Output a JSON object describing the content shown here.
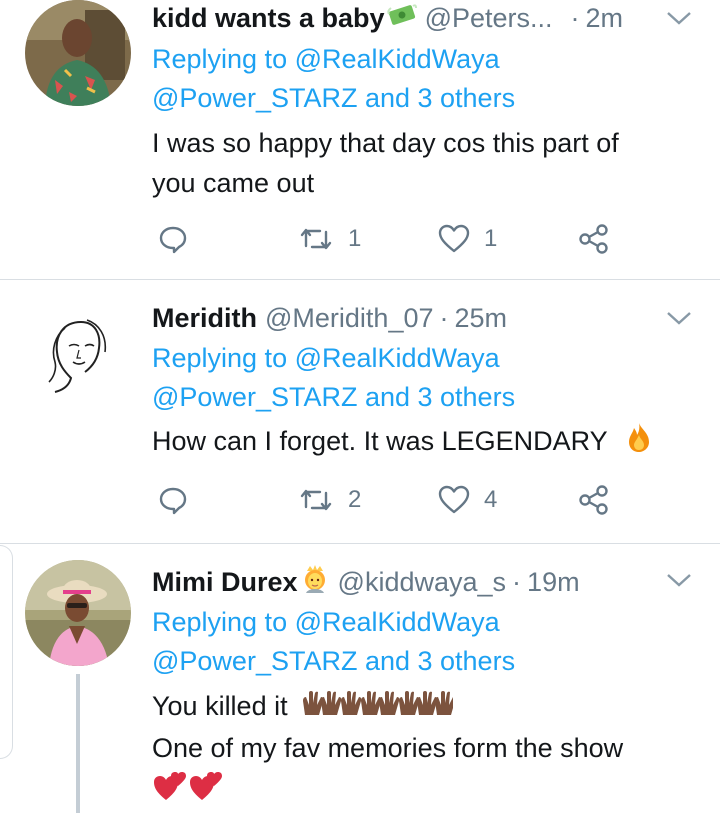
{
  "tweets": [
    {
      "name": "kidd wants a baby",
      "name_emoji": "money-with-wings-emoji",
      "handle": "@Peters...",
      "dot": "·",
      "time": "2m",
      "replying_prefix": "Replying to",
      "replying_to": "@RealKiddWaya",
      "replying_line2": "@Power_STARZ and 3 others",
      "text_lines": [
        "I was so happy that day cos this part of",
        "you came out"
      ],
      "reply_count": "",
      "retweet_count": "1",
      "like_count": "1"
    },
    {
      "name": "Meridith",
      "handle": "@Meridith_07",
      "dot": "·",
      "time": "25m",
      "replying_prefix": "Replying to",
      "replying_to": "@RealKiddWaya",
      "replying_line2": "@Power_STARZ and 3 others",
      "text_lines": [
        "How can I forget. It was LEGENDARY"
      ],
      "text_emoji": "fire-emoji",
      "reply_count": "",
      "retweet_count": "2",
      "like_count": "4"
    },
    {
      "name": "Mimi Durex",
      "name_emoji": "princess-emoji",
      "handle": "@kiddwaya_s",
      "dot": "·",
      "time": "19m",
      "replying_prefix": "Replying to",
      "replying_to": "@RealKiddWaya",
      "replying_line2": "@Power_STARZ and 3 others",
      "text_lines": [
        "You killed it",
        "One of my fav memories form the show"
      ],
      "text_emoji": "raising-hands-emoji",
      "heart_emoji": "two-hearts-emoji"
    }
  ],
  "colors": {
    "link": "#1da1f2",
    "muted": "#657786",
    "text": "#14171a",
    "divider": "#d9dee3"
  }
}
